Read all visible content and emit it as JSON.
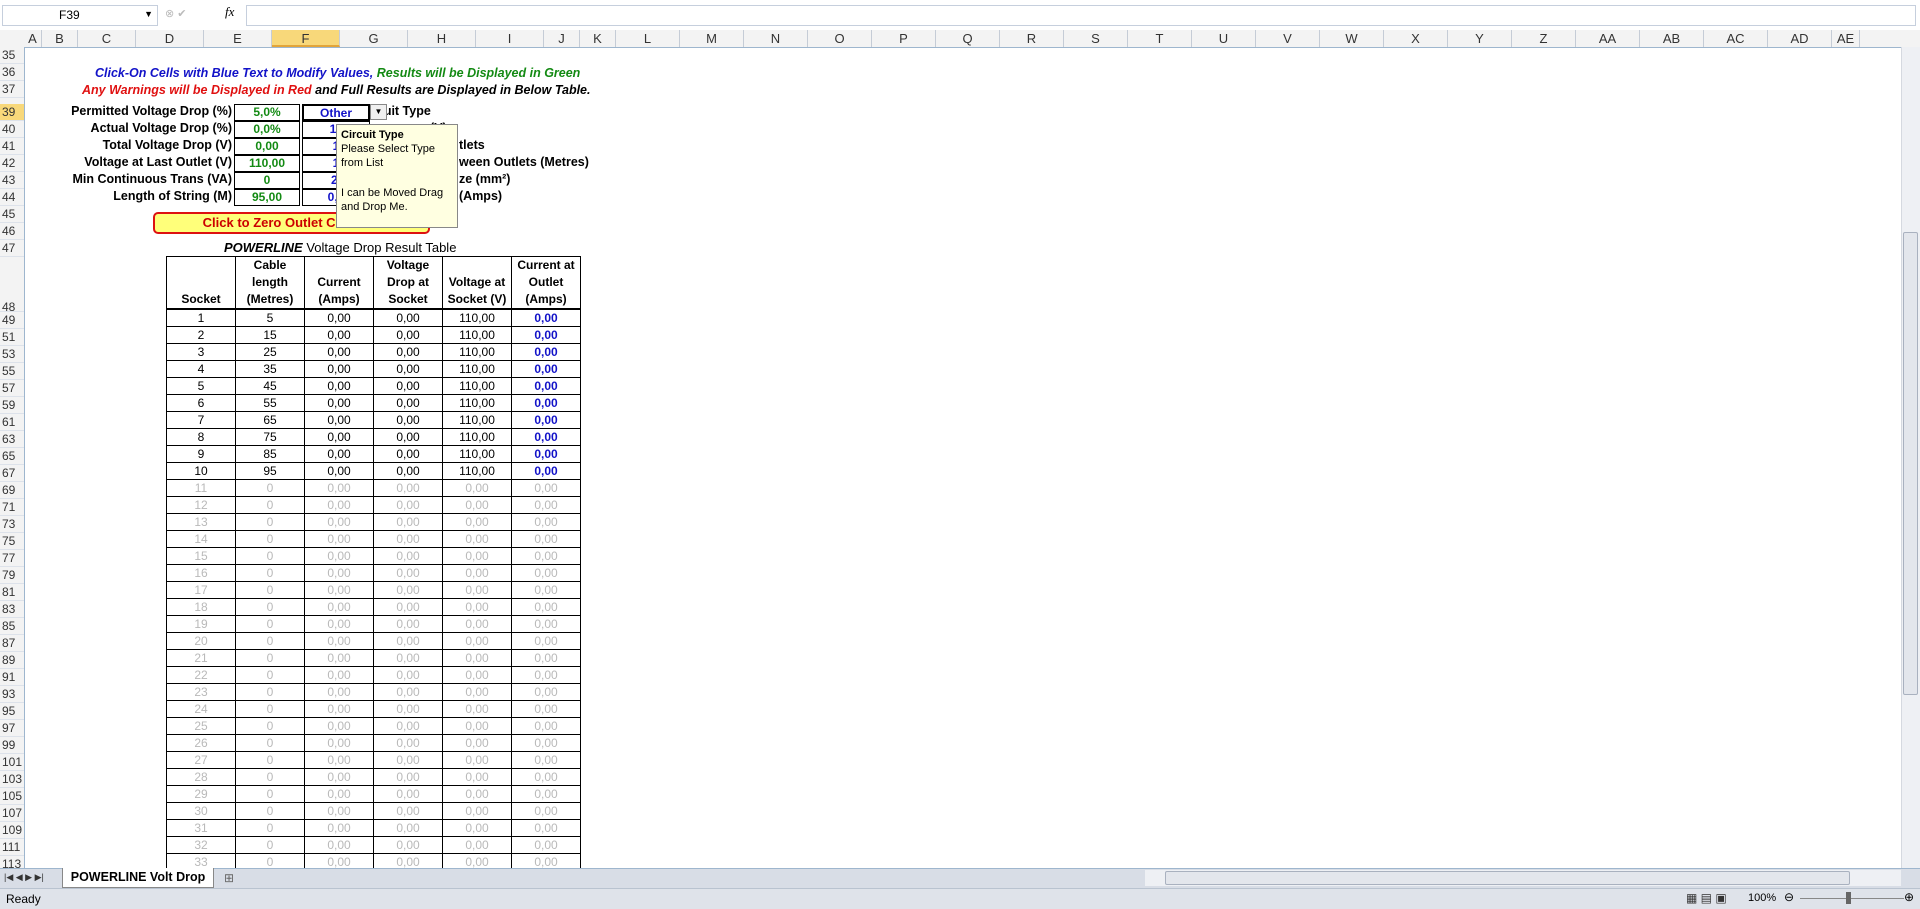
{
  "formula_bar": {
    "name_box": "F39",
    "fx": "fx",
    "value": ""
  },
  "columns": [
    "A",
    "B",
    "C",
    "D",
    "E",
    "F",
    "G",
    "H",
    "I",
    "J",
    "K",
    "L",
    "M",
    "N",
    "O",
    "P",
    "Q",
    "R",
    "S",
    "T",
    "U",
    "V",
    "W",
    "X",
    "Y",
    "Z",
    "AA",
    "AB",
    "AC",
    "AD",
    "AE"
  ],
  "selected_column": "F",
  "rows": [
    "35",
    "36",
    "37",
    "39",
    "40",
    "41",
    "42",
    "43",
    "44",
    "45",
    "46",
    "47",
    "48",
    "49",
    "51",
    "53",
    "55",
    "57",
    "59",
    "61",
    "63",
    "65",
    "67",
    "69",
    "71",
    "73",
    "75",
    "77",
    "79",
    "81",
    "83",
    "85",
    "87",
    "89",
    "91",
    "93",
    "95",
    "97",
    "99",
    "101",
    "103",
    "105",
    "107",
    "109",
    "111",
    "113"
  ],
  "selected_row": "39",
  "instructions": {
    "line1_blue": "Click-On Cells with Blue Text to Modify Values,",
    "line1_green": "Results will be Displayed in Green",
    "line2_red": "Any Warnings will be Displayed in Red",
    "line2_black": "and Full Results are Displayed in Below Table."
  },
  "params": [
    {
      "label": "Permitted Voltage Drop (%)",
      "value": "5,0%",
      "f": "Other",
      "right": "rcuit Type"
    },
    {
      "label": "Actual Voltage Drop (%)",
      "value": "0,0%",
      "f": "11",
      "right": "ge (V)",
      "right_mid": "Supply Volta"
    },
    {
      "label": "Total Voltage Drop (V)",
      "value": "0,00",
      "f": "1",
      "right": "tlets"
    },
    {
      "label": "Voltage at Last Outlet (V)",
      "value": "110,00",
      "f": "1",
      "right": "ween Outlets (Metres)"
    },
    {
      "label": "Min Continuous Trans (VA)",
      "value": "0",
      "f": "2.",
      "right": "ze (mm²)"
    },
    {
      "label": "Length of String (M)",
      "value": "95,00",
      "f": "0,0",
      "right": "(Amps)"
    }
  ],
  "zero_button": "Click to Zero Outlet Currents",
  "tooltip": {
    "title": "Circuit Type",
    "line1": "Please Select Type",
    "line2": "from List",
    "line3": "I can be Moved Drag",
    "line4": "and Drop Me."
  },
  "table": {
    "title_italic": "POWERLINE",
    "title_rest": " Voltage Drop Result Table",
    "headers": [
      "Socket",
      "Cable length (Metres)",
      "Current (Amps)",
      "Voltage Drop at Socket",
      "Voltage at Socket (V)",
      "Current at Outlet (Amps)"
    ],
    "rows": [
      [
        "1",
        "5",
        "0,00",
        "0,00",
        "110,00",
        "0,00"
      ],
      [
        "2",
        "15",
        "0,00",
        "0,00",
        "110,00",
        "0,00"
      ],
      [
        "3",
        "25",
        "0,00",
        "0,00",
        "110,00",
        "0,00"
      ],
      [
        "4",
        "35",
        "0,00",
        "0,00",
        "110,00",
        "0,00"
      ],
      [
        "5",
        "45",
        "0,00",
        "0,00",
        "110,00",
        "0,00"
      ],
      [
        "6",
        "55",
        "0,00",
        "0,00",
        "110,00",
        "0,00"
      ],
      [
        "7",
        "65",
        "0,00",
        "0,00",
        "110,00",
        "0,00"
      ],
      [
        "8",
        "75",
        "0,00",
        "0,00",
        "110,00",
        "0,00"
      ],
      [
        "9",
        "85",
        "0,00",
        "0,00",
        "110,00",
        "0,00"
      ],
      [
        "10",
        "95",
        "0,00",
        "0,00",
        "110,00",
        "0,00"
      ],
      [
        "11",
        "0",
        "0,00",
        "0,00",
        "0,00",
        "0,00"
      ],
      [
        "12",
        "0",
        "0,00",
        "0,00",
        "0,00",
        "0,00"
      ],
      [
        "13",
        "0",
        "0,00",
        "0,00",
        "0,00",
        "0,00"
      ],
      [
        "14",
        "0",
        "0,00",
        "0,00",
        "0,00",
        "0,00"
      ],
      [
        "15",
        "0",
        "0,00",
        "0,00",
        "0,00",
        "0,00"
      ],
      [
        "16",
        "0",
        "0,00",
        "0,00",
        "0,00",
        "0,00"
      ],
      [
        "17",
        "0",
        "0,00",
        "0,00",
        "0,00",
        "0,00"
      ],
      [
        "18",
        "0",
        "0,00",
        "0,00",
        "0,00",
        "0,00"
      ],
      [
        "19",
        "0",
        "0,00",
        "0,00",
        "0,00",
        "0,00"
      ],
      [
        "20",
        "0",
        "0,00",
        "0,00",
        "0,00",
        "0,00"
      ],
      [
        "21",
        "0",
        "0,00",
        "0,00",
        "0,00",
        "0,00"
      ],
      [
        "22",
        "0",
        "0,00",
        "0,00",
        "0,00",
        "0,00"
      ],
      [
        "23",
        "0",
        "0,00",
        "0,00",
        "0,00",
        "0,00"
      ],
      [
        "24",
        "0",
        "0,00",
        "0,00",
        "0,00",
        "0,00"
      ],
      [
        "25",
        "0",
        "0,00",
        "0,00",
        "0,00",
        "0,00"
      ],
      [
        "26",
        "0",
        "0,00",
        "0,00",
        "0,00",
        "0,00"
      ],
      [
        "27",
        "0",
        "0,00",
        "0,00",
        "0,00",
        "0,00"
      ],
      [
        "28",
        "0",
        "0,00",
        "0,00",
        "0,00",
        "0,00"
      ],
      [
        "29",
        "0",
        "0,00",
        "0,00",
        "0,00",
        "0,00"
      ],
      [
        "30",
        "0",
        "0,00",
        "0,00",
        "0,00",
        "0,00"
      ],
      [
        "31",
        "0",
        "0,00",
        "0,00",
        "0,00",
        "0,00"
      ],
      [
        "32",
        "0",
        "0,00",
        "0,00",
        "0,00",
        "0,00"
      ],
      [
        "33",
        "0",
        "0,00",
        "0,00",
        "0,00",
        "0,00"
      ]
    ],
    "active_rows": 10
  },
  "sheet_tab": "POWERLINE Volt Drop",
  "status": {
    "ready": "Ready",
    "zoom": "100%"
  },
  "colors": {
    "accent_selected": "#f8d87a",
    "blue": "#1212c8",
    "green": "#138a13",
    "red": "#e01010"
  }
}
